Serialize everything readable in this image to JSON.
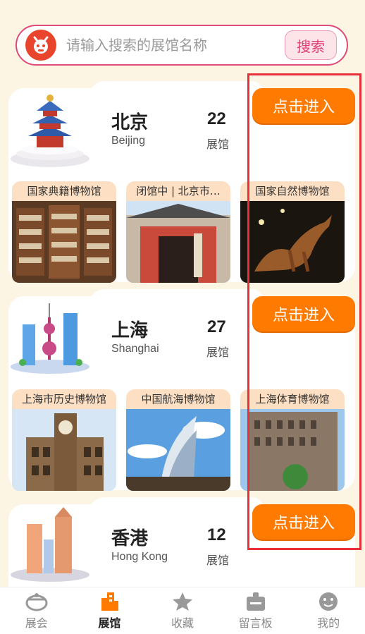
{
  "search": {
    "placeholder": "请输入搜索的展馆名称",
    "button_label": "搜索"
  },
  "cities": [
    {
      "name": "北京",
      "name_en": "Beijing",
      "count": "22",
      "count_unit": "展馆",
      "enter_label": "点击进入",
      "museums": [
        "国家典籍博物馆",
        "闭馆中 | 北京市…",
        "国家自然博物馆"
      ]
    },
    {
      "name": "上海",
      "name_en": "Shanghai",
      "count": "27",
      "count_unit": "展馆",
      "enter_label": "点击进入",
      "museums": [
        "上海市历史博物馆",
        "中国航海博物馆",
        "上海体育博物馆"
      ]
    },
    {
      "name": "香港",
      "name_en": "Hong Kong",
      "count": "12",
      "count_unit": "展馆",
      "enter_label": "点击进入",
      "museums": []
    }
  ],
  "nav": {
    "items": [
      {
        "label": "展会",
        "icon": "exhibition-icon",
        "active": false
      },
      {
        "label": "展馆",
        "icon": "building-icon",
        "active": true
      },
      {
        "label": "收藏",
        "icon": "star-icon",
        "active": false
      },
      {
        "label": "留言板",
        "icon": "message-board-icon",
        "active": false
      },
      {
        "label": "我的",
        "icon": "profile-icon",
        "active": false
      }
    ]
  },
  "colors": {
    "accent": "#ff7a00",
    "search_border": "#e04a79",
    "highlight": "#e8303a",
    "background": "#fdf5e4"
  }
}
